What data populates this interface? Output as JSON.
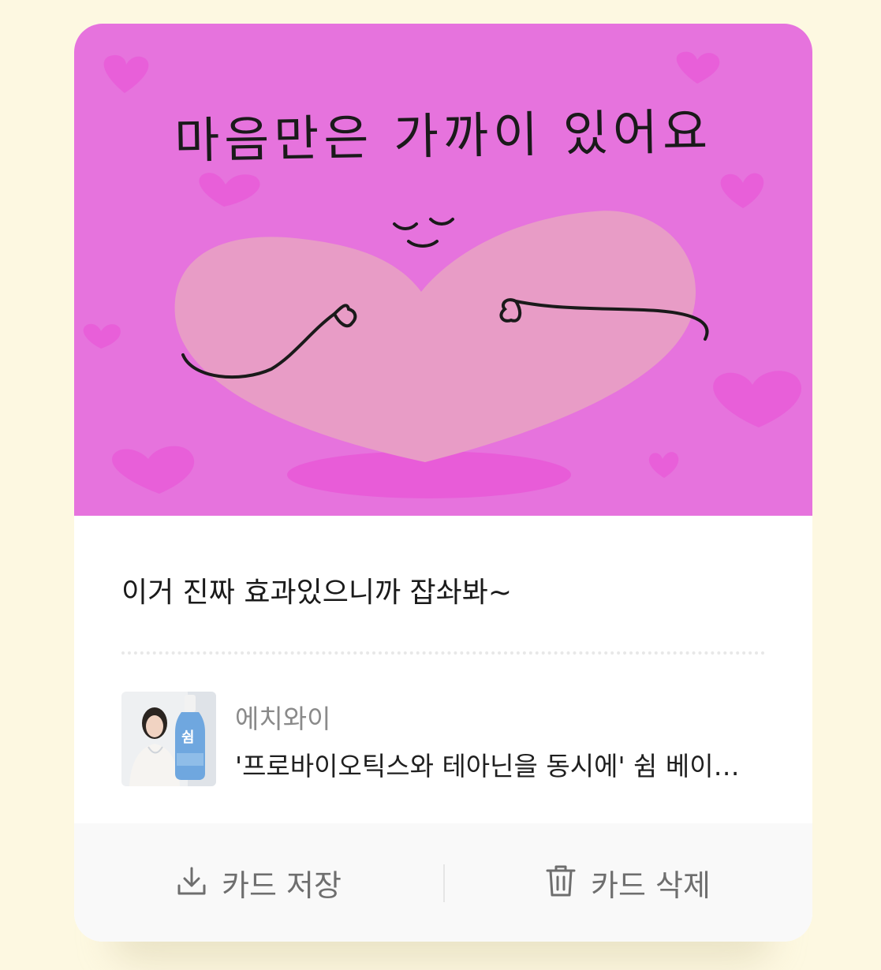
{
  "card": {
    "image_text": "마음만은 가까이 있어요",
    "message": "이거 진짜 효과있으니까 잡솨봐~",
    "product": {
      "brand": "에치와이",
      "name": "'프로바이오틱스와 테아닌을 동시에' 쉼 베이지 음료",
      "thumbnail_label": "쉼"
    },
    "actions": {
      "save_label": "카드 저장",
      "save_icon": "download-icon",
      "delete_label": "카드 삭제",
      "delete_icon": "trash-icon"
    }
  },
  "colors": {
    "page_background": "#fdf8e1",
    "art_background": "#e673dd",
    "big_heart": "#e89cc6",
    "small_hearts": "#e85cd8",
    "action_bar_background": "#f9f9f9",
    "action_text": "#6e6e6e"
  }
}
